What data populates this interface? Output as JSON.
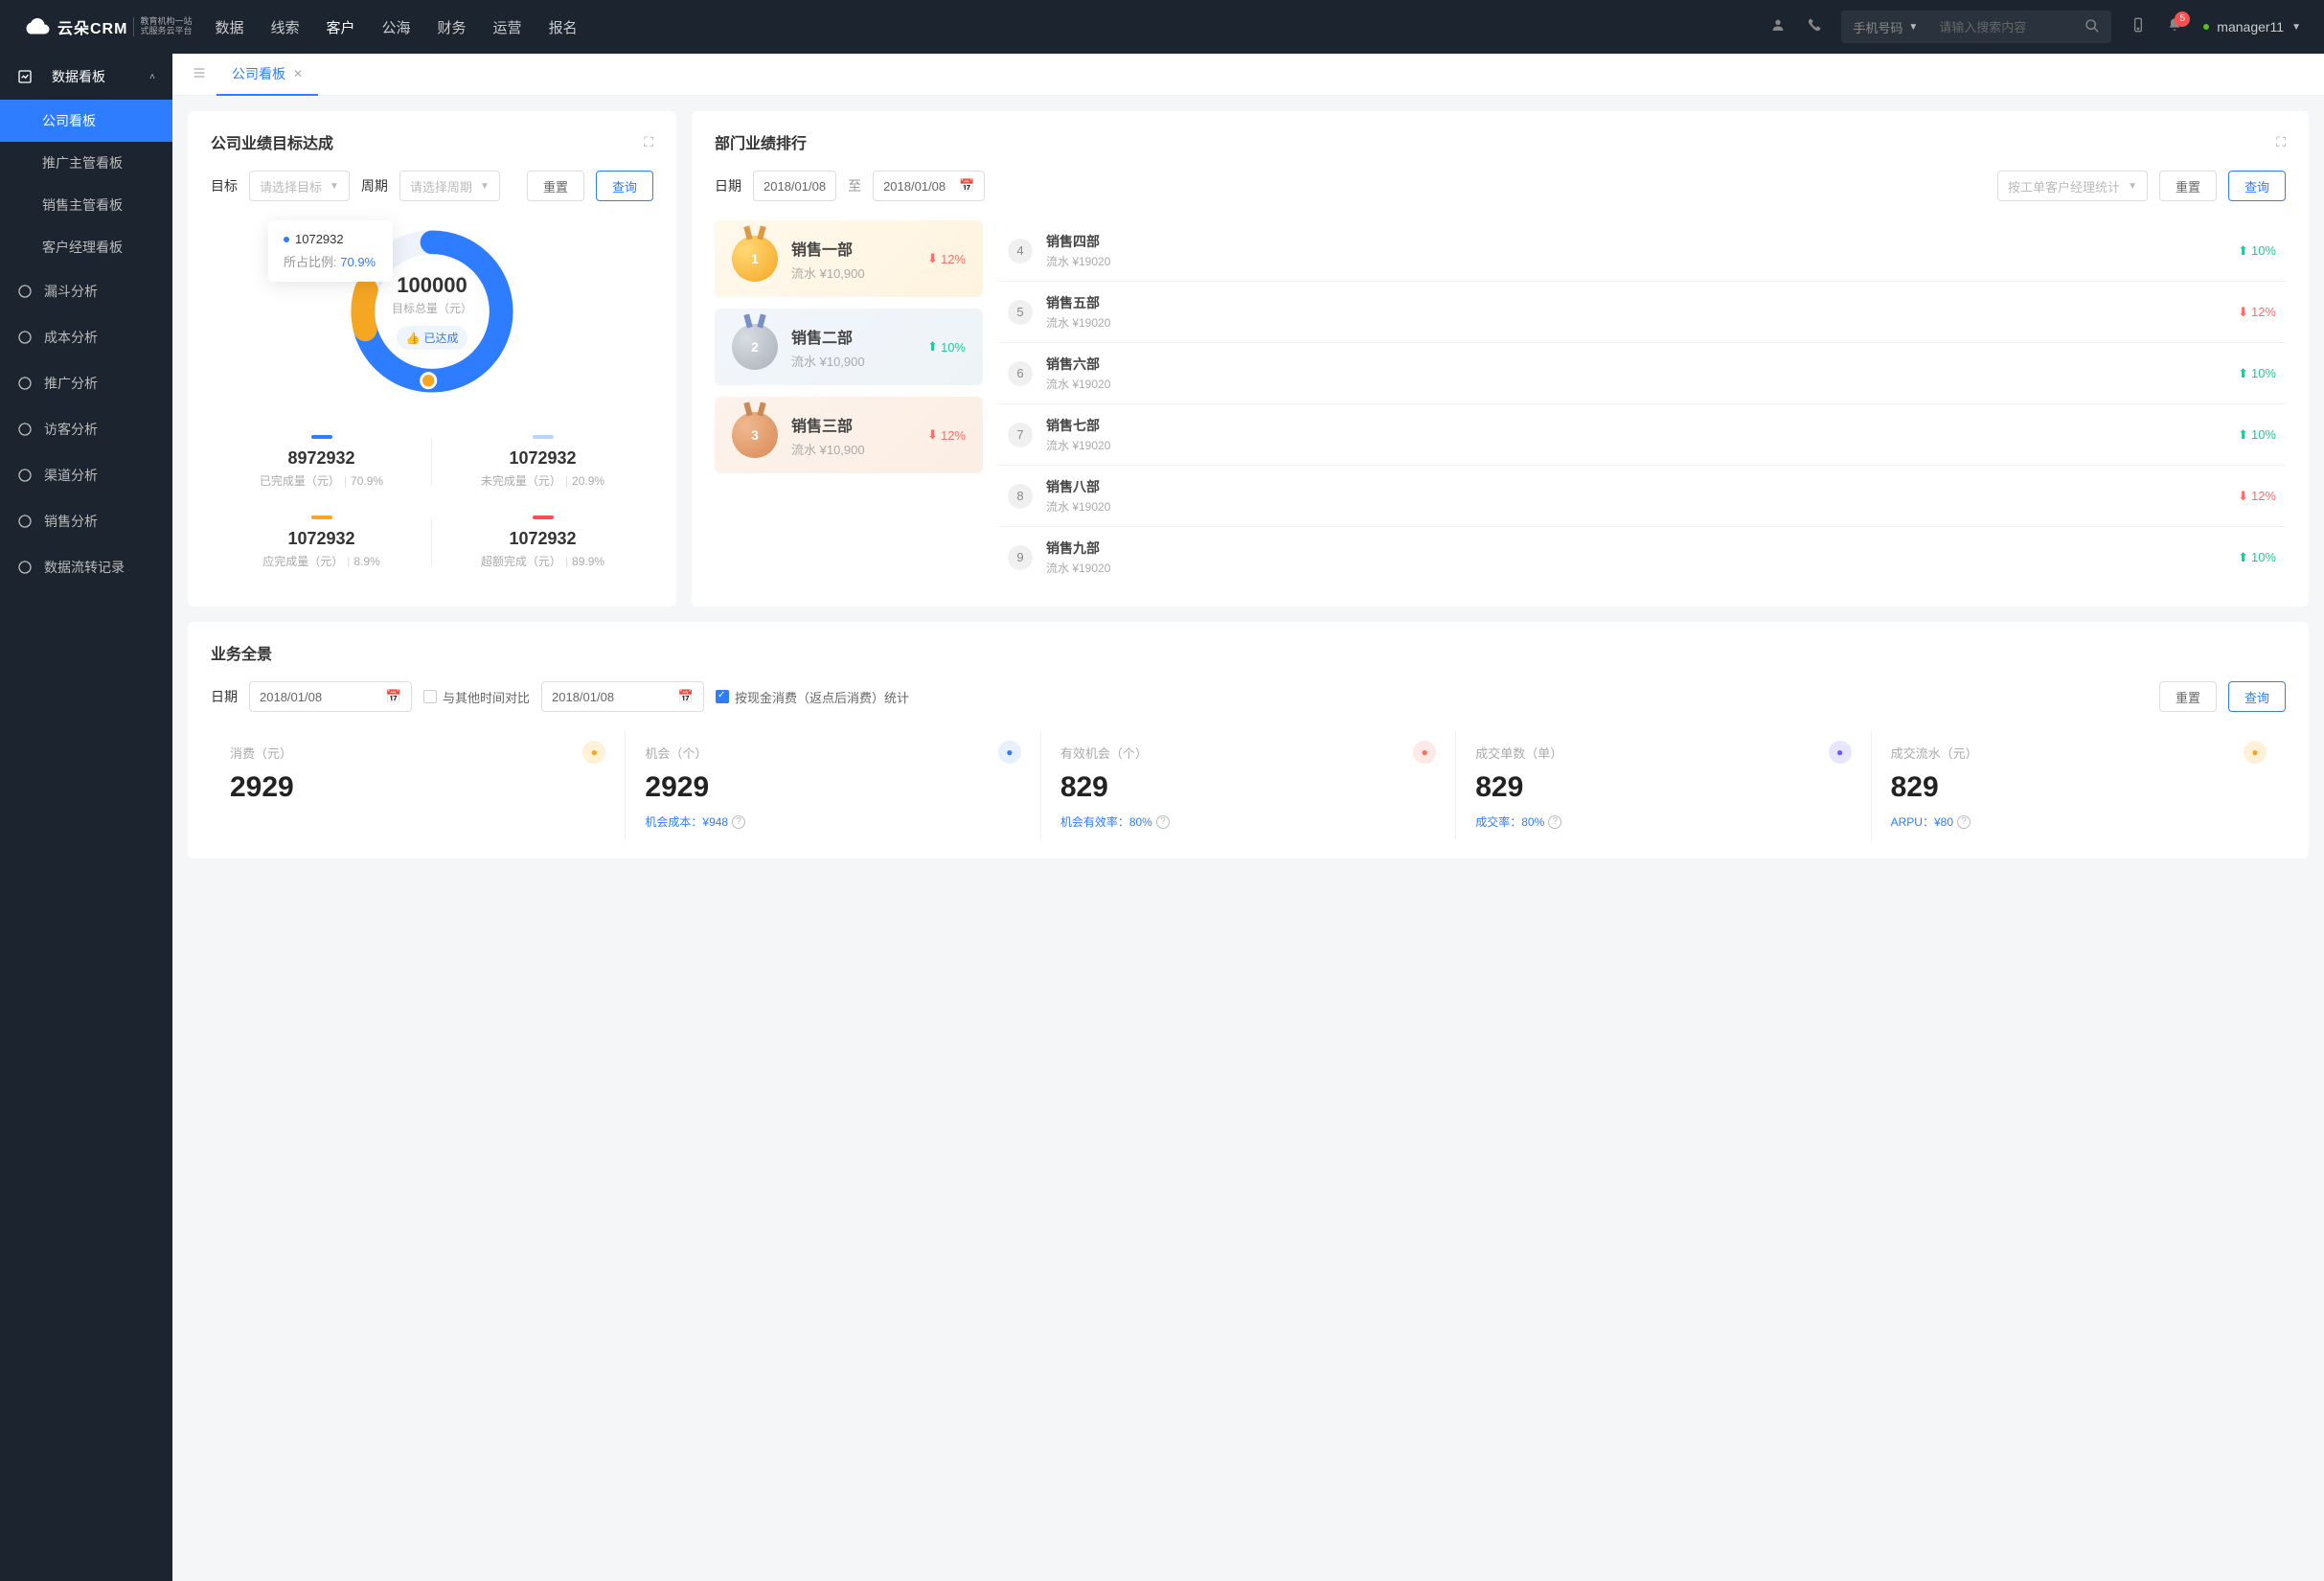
{
  "header": {
    "logo_name": "云朵CRM",
    "logo_sub1": "教育机构一站",
    "logo_sub2": "式服务云平台",
    "nav": [
      "数据",
      "线索",
      "客户",
      "公海",
      "财务",
      "运营",
      "报名"
    ],
    "nav_active": 2,
    "search_type": "手机号码",
    "search_placeholder": "请输入搜索内容",
    "notif_count": "5",
    "user": "manager11"
  },
  "sidebar": {
    "group": "数据看板",
    "children": [
      "公司看板",
      "推广主管看板",
      "销售主管看板",
      "客户经理看板"
    ],
    "child_active": 0,
    "items": [
      "漏斗分析",
      "成本分析",
      "推广分析",
      "访客分析",
      "渠道分析",
      "销售分析",
      "数据流转记录"
    ]
  },
  "tabs": {
    "current": "公司看板"
  },
  "goal_panel": {
    "title": "公司业绩目标达成",
    "label_target": "目标",
    "target_placeholder": "请选择目标",
    "label_period": "周期",
    "period_placeholder": "请选择周期",
    "btn_reset": "重置",
    "btn_query": "查询",
    "tooltip_value": "1072932",
    "tooltip_label": "所占比例:",
    "tooltip_pct": "70.9%",
    "center_value": "100000",
    "center_label": "目标总量（元）",
    "center_tag": "已达成",
    "stats": [
      {
        "color": "#2e7cff",
        "value": "8972932",
        "label": "已完成量（元）",
        "pct": "70.9%"
      },
      {
        "color": "#b8d4ff",
        "value": "1072932",
        "label": "未完成量（元）",
        "pct": "20.9%"
      },
      {
        "color": "#f5a623",
        "value": "1072932",
        "label": "应完成量（元）",
        "pct": "8.9%"
      },
      {
        "color": "#ff4d4f",
        "value": "1072932",
        "label": "超额完成（元）",
        "pct": "89.9%"
      }
    ]
  },
  "rank_panel": {
    "title": "部门业绩排行",
    "label_date": "日期",
    "date_from": "2018/01/08",
    "date_sep": "至",
    "date_to": "2018/01/08",
    "stat_type": "按工单客户经理统计",
    "btn_reset": "重置",
    "btn_query": "查询",
    "top": [
      {
        "rank": "1",
        "name": "销售一部",
        "flow_label": "流水 ¥10,900",
        "pct": "12%",
        "dir": "down"
      },
      {
        "rank": "2",
        "name": "销售二部",
        "flow_label": "流水 ¥10,900",
        "pct": "10%",
        "dir": "up"
      },
      {
        "rank": "3",
        "name": "销售三部",
        "flow_label": "流水 ¥10,900",
        "pct": "12%",
        "dir": "down"
      }
    ],
    "rest": [
      {
        "rank": "4",
        "name": "销售四部",
        "flow_label": "流水 ¥19020",
        "pct": "10%",
        "dir": "up"
      },
      {
        "rank": "5",
        "name": "销售五部",
        "flow_label": "流水 ¥19020",
        "pct": "12%",
        "dir": "down"
      },
      {
        "rank": "6",
        "name": "销售六部",
        "flow_label": "流水 ¥19020",
        "pct": "10%",
        "dir": "up"
      },
      {
        "rank": "7",
        "name": "销售七部",
        "flow_label": "流水 ¥19020",
        "pct": "10%",
        "dir": "up"
      },
      {
        "rank": "8",
        "name": "销售八部",
        "flow_label": "流水 ¥19020",
        "pct": "12%",
        "dir": "down"
      },
      {
        "rank": "9",
        "name": "销售九部",
        "flow_label": "流水 ¥19020",
        "pct": "10%",
        "dir": "up"
      }
    ]
  },
  "overview": {
    "title": "业务全景",
    "label_date": "日期",
    "date1": "2018/01/08",
    "compare_label": "与其他时间对比",
    "date2": "2018/01/08",
    "cash_label": "按现金消费（返点后消费）统计",
    "btn_reset": "重置",
    "btn_query": "查询",
    "metrics": [
      {
        "label": "消费（元）",
        "value": "2929",
        "icon_bg": "#fff1d6",
        "icon_fg": "#f5a623",
        "icon": "bag-icon",
        "sub": ""
      },
      {
        "label": "机会（个）",
        "value": "2929",
        "icon_bg": "#e6f0ff",
        "icon_fg": "#2e7cff",
        "icon": "send-icon",
        "sub_label": "机会成本：",
        "sub_val": "¥948"
      },
      {
        "label": "有效机会（个）",
        "value": "829",
        "icon_bg": "#ffe9e6",
        "icon_fg": "#ff6b4d",
        "icon": "shield-icon",
        "sub_label": "机会有效率：",
        "sub_val": "80%"
      },
      {
        "label": "成交单数（单）",
        "value": "829",
        "icon_bg": "#e8e6ff",
        "icon_fg": "#6b5bff",
        "icon": "file-icon",
        "sub_label": "成交率：",
        "sub_val": "80%"
      },
      {
        "label": "成交流水（元）",
        "value": "829",
        "icon_bg": "#fff1d6",
        "icon_fg": "#f5a623",
        "icon": "card-icon",
        "sub_label": "ARPU：",
        "sub_val": "¥80"
      }
    ]
  },
  "chart_data": {
    "type": "pie",
    "title": "目标总量（元）100000",
    "series": [
      {
        "name": "已完成量",
        "value": 8972932,
        "pct": 70.9,
        "color": "#2e7cff"
      },
      {
        "name": "未完成量",
        "value": 1072932,
        "pct": 20.9,
        "color": "#b8d4ff"
      },
      {
        "name": "应完成量",
        "value": 1072932,
        "pct": 8.9,
        "color": "#f5a623"
      }
    ]
  }
}
